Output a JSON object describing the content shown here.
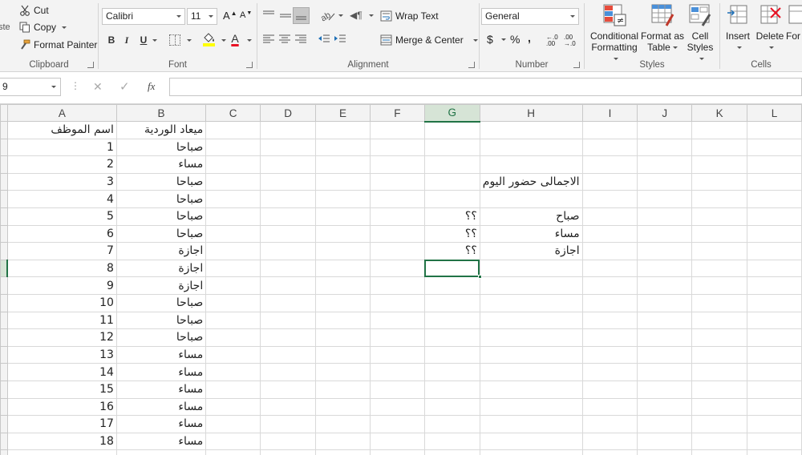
{
  "ribbon": {
    "clipboard": {
      "paste_label": "ste",
      "cut_label": "Cut",
      "copy_label": "Copy",
      "format_painter_label": "Format Painter",
      "group_label": "Clipboard"
    },
    "font": {
      "font_name": "Calibri",
      "font_size": "11",
      "grow_label": "A",
      "shrink_label": "A",
      "bold": "B",
      "italic": "I",
      "underline": "U",
      "font_color_letter": "A",
      "group_label": "Font"
    },
    "alignment": {
      "wrap_text_label": "Wrap Text",
      "merge_center_label": "Merge & Center",
      "group_label": "Alignment"
    },
    "number": {
      "format": "General",
      "currency": "$",
      "percent": "%",
      "comma": ",",
      "increase_decimal": "←.0 .00",
      "decrease_decimal": ".00 →.0",
      "group_label": "Number"
    },
    "styles": {
      "conditional_formatting_line1": "Conditional",
      "conditional_formatting_line2": "Formatting",
      "format_as_table_line1": "Format as",
      "format_as_table_line2": "Table",
      "cell_styles_line1": "Cell",
      "cell_styles_line2": "Styles",
      "group_label": "Styles"
    },
    "cells": {
      "insert_label": "Insert",
      "delete_label": "Delete",
      "format_label": "For",
      "group_label": "Cells"
    }
  },
  "formula_bar": {
    "name_box": "9",
    "cancel": "✕",
    "enter": "✓",
    "fx": "fx",
    "value": ""
  },
  "sheet": {
    "columns": [
      "A",
      "B",
      "C",
      "D",
      "E",
      "F",
      "G",
      "H",
      "I",
      "J",
      "K",
      "L"
    ],
    "selected_column": "G",
    "selected_row_index": 8,
    "header_row": {
      "A": "اسم الموظف",
      "B": "ميعاد الوردية"
    },
    "rows": [
      {
        "A": "1",
        "B": "صباحا",
        "G": "",
        "H": ""
      },
      {
        "A": "2",
        "B": "مساء",
        "G": "",
        "H": ""
      },
      {
        "A": "3",
        "B": "صباحا",
        "G": "",
        "H": "الاجمالى حضور اليوم"
      },
      {
        "A": "4",
        "B": "صباحا",
        "G": "",
        "H": ""
      },
      {
        "A": "5",
        "B": "صباحا",
        "G": "؟؟",
        "H": "صباح"
      },
      {
        "A": "6",
        "B": "صباحا",
        "G": "؟؟",
        "H": "مساء"
      },
      {
        "A": "7",
        "B": "اجازة",
        "G": "؟؟",
        "H": "اجازة"
      },
      {
        "A": "8",
        "B": "اجازة",
        "G": "",
        "H": ""
      },
      {
        "A": "9",
        "B": "اجازة",
        "G": "",
        "H": ""
      },
      {
        "A": "10",
        "B": "صباحا",
        "G": "",
        "H": ""
      },
      {
        "A": "11",
        "B": "صباحا",
        "G": "",
        "H": ""
      },
      {
        "A": "12",
        "B": "صباحا",
        "G": "",
        "H": ""
      },
      {
        "A": "13",
        "B": "مساء",
        "G": "",
        "H": ""
      },
      {
        "A": "14",
        "B": "مساء",
        "G": "",
        "H": ""
      },
      {
        "A": "15",
        "B": "مساء",
        "G": "",
        "H": ""
      },
      {
        "A": "16",
        "B": "مساء",
        "G": "",
        "H": ""
      },
      {
        "A": "17",
        "B": "مساء",
        "G": "",
        "H": ""
      },
      {
        "A": "18",
        "B": "مساء",
        "G": "",
        "H": ""
      },
      {
        "A": "",
        "B": "",
        "G": "",
        "H": ""
      }
    ]
  },
  "colors": {
    "excel_green": "#217346",
    "font_color_bar": "#e81123",
    "highlight_bar": "#ffff00"
  }
}
